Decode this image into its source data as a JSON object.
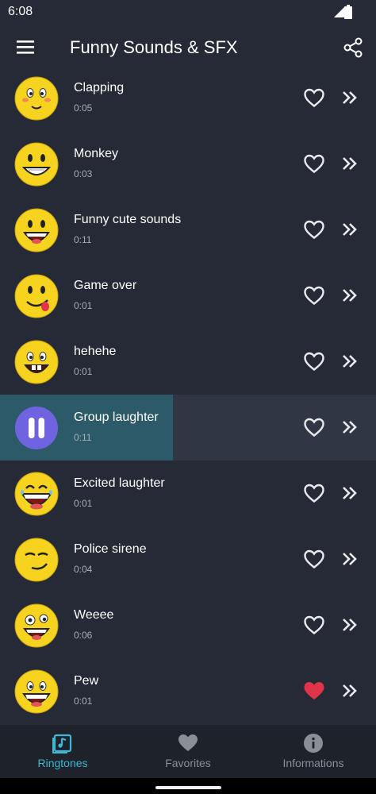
{
  "status": {
    "time": "6:08"
  },
  "app": {
    "title": "Funny Sounds & SFX"
  },
  "colors": {
    "background": "#252a36",
    "accent": "#3fb6d2",
    "favorite": "#e0344a",
    "play_button": "#6f63e0",
    "progress": "#2d5a68"
  },
  "sounds": [
    {
      "name": "Clapping",
      "duration": "0:05",
      "face": "blush-face-icon",
      "favorite": false
    },
    {
      "name": "Monkey",
      "duration": "0:03",
      "face": "grin-face-icon",
      "favorite": false
    },
    {
      "name": "Funny cute sounds",
      "duration": "0:11",
      "face": "laugh-face-icon",
      "favorite": false
    },
    {
      "name": "Game over",
      "duration": "0:01",
      "face": "tongue-face-icon",
      "favorite": false
    },
    {
      "name": "hehehe",
      "duration": "0:01",
      "face": "buck-teeth-face-icon",
      "favorite": false
    },
    {
      "name": "Group laughter",
      "duration": "0:11",
      "face": "pause-icon",
      "favorite": false,
      "playing": true,
      "progress": 0.46
    },
    {
      "name": "Excited laughter",
      "duration": "0:01",
      "face": "excited-face-icon",
      "favorite": false
    },
    {
      "name": "Police sirene",
      "duration": "0:04",
      "face": "smirk-face-icon",
      "favorite": false
    },
    {
      "name": "Weeee",
      "duration": "0:06",
      "face": "crazy-face-icon",
      "favorite": false
    },
    {
      "name": "Pew",
      "duration": "0:01",
      "face": "happy-face-icon",
      "favorite": true
    }
  ],
  "nav": [
    {
      "label": "Ringtones",
      "icon": "music-note-icon",
      "active": true
    },
    {
      "label": "Favorites",
      "icon": "heart-icon",
      "active": false
    },
    {
      "label": "Informations",
      "icon": "info-icon",
      "active": false
    }
  ]
}
